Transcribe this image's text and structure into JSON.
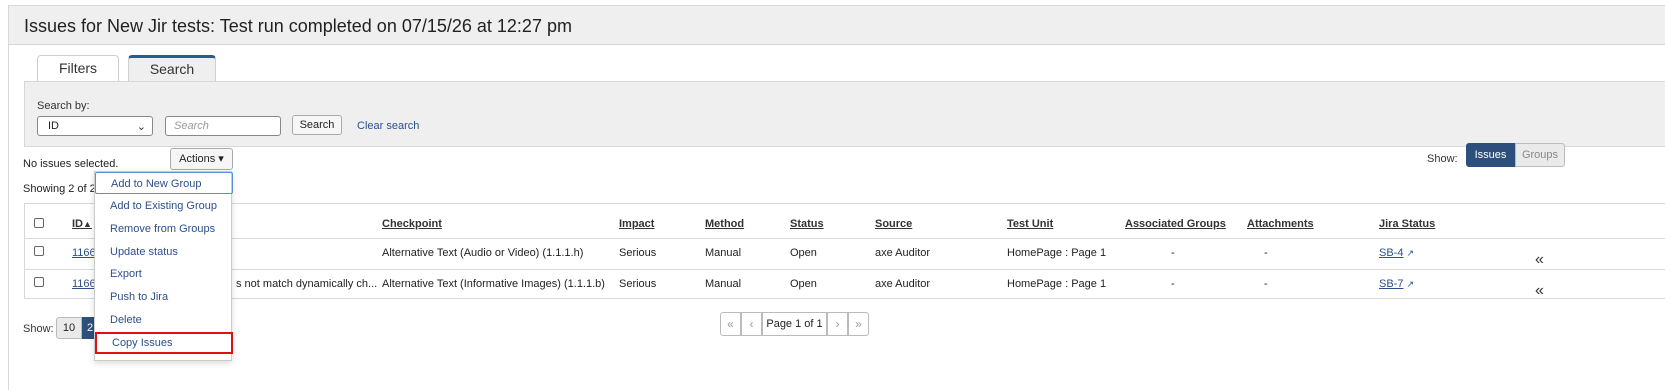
{
  "page": {
    "title": "Issues for New Jir tests: Test run completed on 07/15/26 at 12:27 pm"
  },
  "tabs": [
    {
      "label": "Filters",
      "active": false
    },
    {
      "label": "Search",
      "active": true
    }
  ],
  "search": {
    "by_label": "Search by:",
    "field_value": "ID",
    "placeholder": "Search",
    "button_label": "Search",
    "clear_label": "Clear search"
  },
  "selection": {
    "status": "No issues selected.",
    "actions_label": "Actions ▾",
    "showing": "Showing 2 of 2"
  },
  "view_toggle": {
    "label": "Show:",
    "options": [
      "Issues",
      "Groups"
    ],
    "selected": "Issues"
  },
  "table": {
    "headers": {
      "id": "ID",
      "id_sort": "▲",
      "checkpoint": "Checkpoint",
      "impact": "Impact",
      "method": "Method",
      "status": "Status",
      "source": "Source",
      "test_unit": "Test Unit",
      "groups": "Associated Groups",
      "attachments": "Attachments",
      "jira_status": "Jira Status"
    },
    "rows": [
      {
        "id": "1166",
        "summary": "",
        "checkpoint": "Alternative Text (Audio or Video) (1.1.1.h)",
        "impact": "Serious",
        "method": "Manual",
        "status": "Open",
        "source": "axe Auditor",
        "test_unit": "HomePage : Page 1",
        "groups": "-",
        "attachments": "-",
        "jira": "SB-4"
      },
      {
        "id": "1166",
        "summary": "s not match dynamically ch...",
        "checkpoint": "Alternative Text (Informative Images) (1.1.1.b)",
        "impact": "Serious",
        "method": "Manual",
        "status": "Open",
        "source": "axe Auditor",
        "test_unit": "HomePage : Page 1",
        "groups": "-",
        "attachments": "-",
        "jira": "SB-7"
      }
    ]
  },
  "page_size": {
    "label": "Show:",
    "options": [
      "10",
      "2"
    ],
    "selected": "2"
  },
  "pagination": {
    "first": "«",
    "prev": "‹",
    "label": "Page 1 of 1",
    "next": "›",
    "last": "»"
  },
  "actions_menu": {
    "items": [
      "Add to New Group",
      "Add to Existing Group",
      "Remove from Groups",
      "Update status",
      "Export",
      "Push to Jira",
      "Delete",
      "Copy Issues"
    ],
    "focused": "Add to New Group",
    "highlighted": "Copy Issues"
  },
  "icons": {
    "external_link": "↗",
    "collapse": "«",
    "chevron_down": "⌄"
  },
  "colors": {
    "accent": "#2d4f7c",
    "link": "#2d4f8c",
    "highlight_border": "#e01010",
    "focus_border": "#5b8fd6"
  }
}
